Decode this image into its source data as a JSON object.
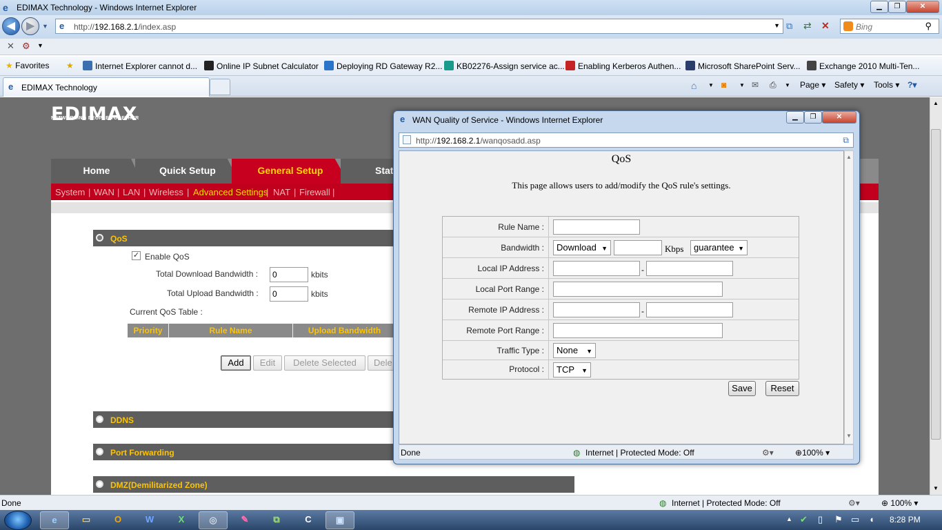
{
  "ie": {
    "window_title": "EDIMAX Technology - Windows Internet Explorer",
    "url_prefix": "http://",
    "url_host": "192.168.2.1",
    "url_path": "/index.asp",
    "search_placeholder": "Bing",
    "favorites_label": "Favorites",
    "favorites": [
      "Internet Explorer cannot d...",
      "Online IP Subnet Calculator",
      "Deploying RD Gateway R2...",
      "KB02276-Assign service ac...",
      "Enabling Kerberos Authen...",
      "Microsoft SharePoint Serv...",
      "Exchange 2010 Multi-Ten..."
    ],
    "tab_title": "EDIMAX Technology",
    "tools": {
      "page": "Page",
      "safety": "Safety",
      "tools": "Tools"
    },
    "status_left": "Done",
    "status_zone": "Internet | Protected Mode: Off",
    "zoom": "100%"
  },
  "router": {
    "logo": "EDIMAX",
    "slogan": "NETWORKING PEOPLE TOGETHER",
    "tabs": [
      "Home",
      "Quick Setup",
      "General Setup",
      "Stat"
    ],
    "subnav": [
      "System",
      "|",
      "WAN",
      "|",
      "LAN",
      "|",
      "Wireless",
      "|",
      "Advanced Settings",
      "|",
      "NAT",
      "|",
      "Firewall",
      "|"
    ],
    "qos_section": "QoS",
    "enable_qos": "Enable QoS",
    "total_download_label": "Total Download Bandwidth :",
    "total_download_value": "0",
    "total_upload_label": "Total Upload Bandwidth :",
    "total_upload_value": "0",
    "unit_kbits": "kbits",
    "current_table_label": "Current QoS Table :",
    "table_headers": [
      "Priority",
      "Rule Name",
      "Upload Bandwidth"
    ],
    "buttons": {
      "add": "Add",
      "edit": "Edit",
      "delete_selected": "Delete Selected",
      "delete_all": "Dele"
    },
    "sections": [
      "DDNS",
      "Port Forwarding",
      "DMZ(Demilitarized Zone)"
    ]
  },
  "popup": {
    "window_title": "WAN Quality of Service - Windows Internet Explorer",
    "url_prefix": "http://",
    "url_host": "192.168.2.1",
    "url_path": "/wanqosadd.asp",
    "heading": "QoS",
    "description": "This page allows users to add/modify the QoS rule's settings.",
    "rule_name_label": "Rule Name :",
    "bandwidth_label": "Bandwidth :",
    "bandwidth_direction": "Download",
    "bandwidth_unit": "Kbps",
    "bandwidth_type": "guarantee",
    "local_ip_label": "Local IP Address :",
    "local_port_label": "Local Port Range :",
    "remote_ip_label": "Remote IP Address :",
    "remote_port_label": "Remote Port Range :",
    "traffic_type_label": "Traffic Type :",
    "traffic_type_value": "None",
    "protocol_label": "Protocol :",
    "protocol_value": "TCP",
    "dash": "-",
    "save": "Save",
    "reset": "Reset",
    "status_left": "Done",
    "status_zone": "Internet | Protected Mode: Off",
    "zoom": "100%"
  },
  "taskbar": {
    "clock": "8:28 PM"
  },
  "colors": {
    "edimax_red": "#c0001d",
    "active_tab": "#c8001f",
    "accent_yellow": "#ffc400"
  }
}
